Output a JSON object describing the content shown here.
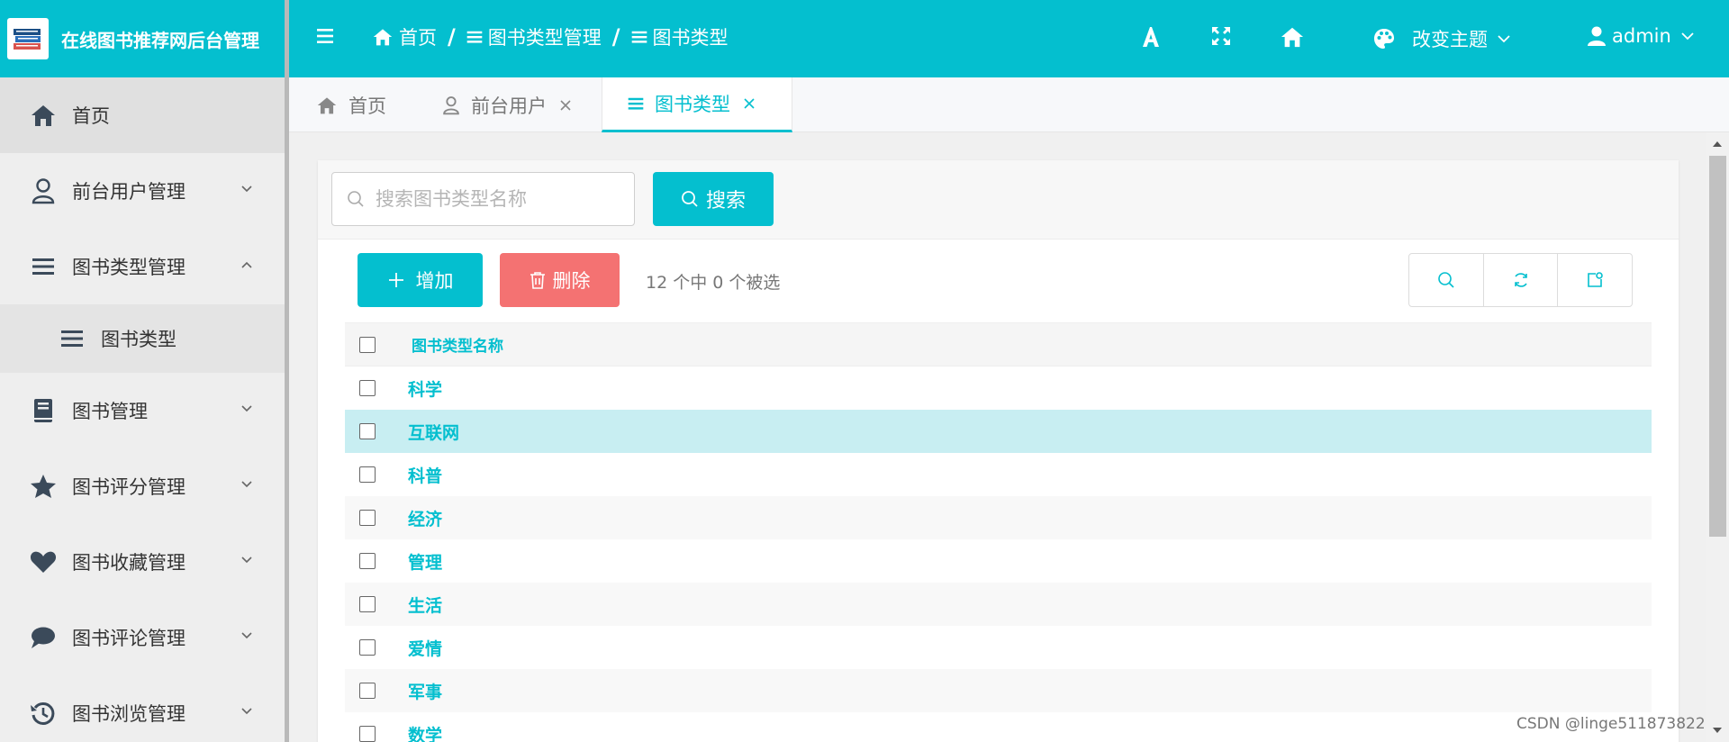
{
  "app": {
    "title": "在线图书推荐网后台管理"
  },
  "sidebar": {
    "items": [
      {
        "label": "首页",
        "icon": "home-icon"
      },
      {
        "label": "前台用户管理",
        "icon": "user-icon"
      },
      {
        "label": "图书类型管理",
        "icon": "list-icon"
      },
      {
        "label": "图书类型",
        "icon": "list-icon"
      },
      {
        "label": "图书管理",
        "icon": "book-icon"
      },
      {
        "label": "图书评分管理",
        "icon": "star-icon"
      },
      {
        "label": "图书收藏管理",
        "icon": "heart-icon"
      },
      {
        "label": "图书评论管理",
        "icon": "comment-icon"
      },
      {
        "label": "图书浏览管理",
        "icon": "history-icon"
      }
    ]
  },
  "header": {
    "breadcrumb": [
      "首页",
      "图书类型管理",
      "图书类型"
    ],
    "theme_label": "改变主题",
    "user_label": "admin"
  },
  "tabs": [
    {
      "label": "首页"
    },
    {
      "label": "前台用户"
    },
    {
      "label": "图书类型"
    }
  ],
  "search": {
    "placeholder": "搜索图书类型名称",
    "button_label": "搜索"
  },
  "toolbar": {
    "add_label": "增加",
    "delete_label": "删除",
    "selection_text": "12 个中 0 个被选"
  },
  "table": {
    "header": "图书类型名称",
    "rows": [
      "科学",
      "互联网",
      "科普",
      "经济",
      "管理",
      "生活",
      "爱情",
      "军事",
      "数学"
    ]
  },
  "colors": {
    "accent": "#04bfcf",
    "danger": "#f47272",
    "highlight": "#c8eef2"
  },
  "watermark": "CSDN @linge511873822"
}
